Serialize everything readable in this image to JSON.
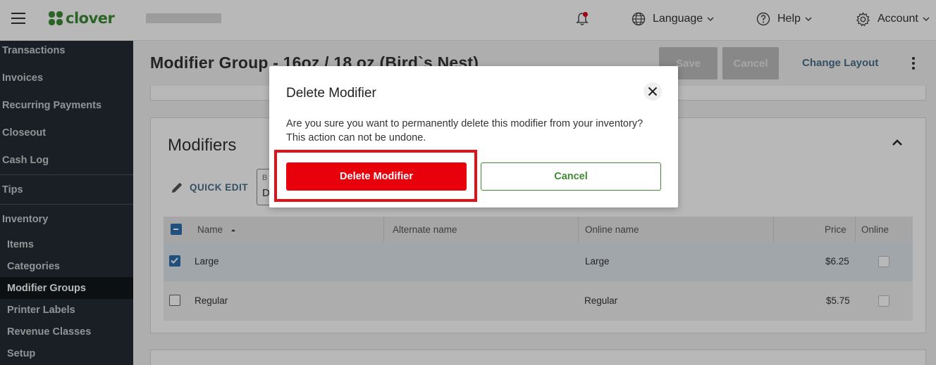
{
  "header": {
    "brand": "clover",
    "language_label": "Language",
    "help_label": "Help",
    "account_label": "Account"
  },
  "sidebar": {
    "items": [
      {
        "label": "Transactions"
      },
      {
        "label": "Invoices"
      },
      {
        "label": "Recurring Payments"
      },
      {
        "label": "Closeout"
      },
      {
        "label": "Cash Log"
      },
      {
        "label": "Tips"
      },
      {
        "label": "Inventory"
      },
      {
        "label": "Items"
      },
      {
        "label": "Categories"
      },
      {
        "label": "Modifier Groups",
        "active": true
      },
      {
        "label": "Printer Labels"
      },
      {
        "label": "Revenue Classes"
      },
      {
        "label": "Setup"
      }
    ]
  },
  "page": {
    "title": "Modifier Group - 16oz / 18 oz (Bird`s Nest)",
    "save_label": "Save",
    "cancel_label": "Cancel",
    "change_layout_label": "Change Layout"
  },
  "modifiers": {
    "section_title": "Modifiers",
    "quick_edit_label": "QUICK EDIT",
    "bulk_partial_1": "B",
    "bulk_partial_2": "D",
    "columns": [
      "Name",
      "Alternate name",
      "Online name",
      "Price",
      "Online"
    ],
    "rows": [
      {
        "name": "Large",
        "alternate": "",
        "online_name": "Large",
        "price": "$6.25",
        "selected": true
      },
      {
        "name": "Regular",
        "alternate": "",
        "online_name": "Regular",
        "price": "$5.75",
        "selected": false
      }
    ]
  },
  "modal": {
    "title": "Delete Modifier",
    "body": "Are you sure you want to permanently delete this modifier from your inventory? This action can not be undone.",
    "delete_label": "Delete Modifier",
    "cancel_label": "Cancel"
  },
  "colors": {
    "brand_green": "#3d8b37",
    "danger_red": "#e8000b",
    "sidebar_bg": "#232c32",
    "link_blue": "#4a6f8a"
  }
}
